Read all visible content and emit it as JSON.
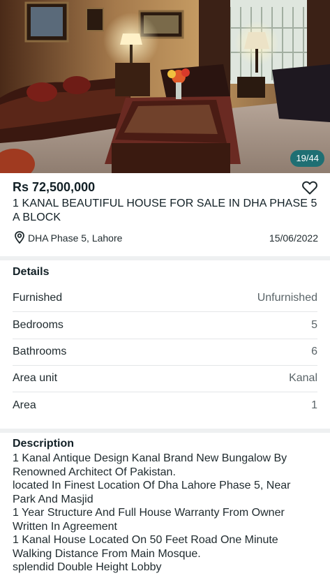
{
  "photo": {
    "alt": "Living room photo",
    "counter": "19/44"
  },
  "listing": {
    "price": "Rs 72,500,000",
    "title": "1 KANAL BEAUTIFUL HOUSE FOR SALE IN DHA PHASE 5 A BLOCK",
    "location": "DHA Phase 5, Lahore",
    "date": "15/06/2022"
  },
  "details": {
    "heading": "Details",
    "rows": [
      {
        "label": "Furnished",
        "value": "Unfurnished"
      },
      {
        "label": "Bedrooms",
        "value": "5"
      },
      {
        "label": "Bathrooms",
        "value": "6"
      },
      {
        "label": "Area unit",
        "value": "Kanal"
      },
      {
        "label": "Area",
        "value": "1"
      }
    ]
  },
  "description": {
    "heading": "Description",
    "lines": [
      "1 Kanal Antique Design Kanal Brand New Bungalow By",
      "Renowned Architect Of Pakistan.",
      "located In Finest Location Of Dha Lahore Phase 5, Near",
      "Park And Masjid",
      "1 Year Structure And Full House Warranty From Owner",
      "Written In Agreement",
      "1 Kanal House Located On 50 Feet Road One Minute",
      "Walking Distance From Main Mosque.",
      "splendid Double Height Lobby"
    ]
  },
  "colors": {
    "accent": "#1f6f73",
    "text": "#1f2a2e"
  },
  "icons": {
    "favorite": "heart-outline-icon",
    "location": "location-pin-icon"
  }
}
